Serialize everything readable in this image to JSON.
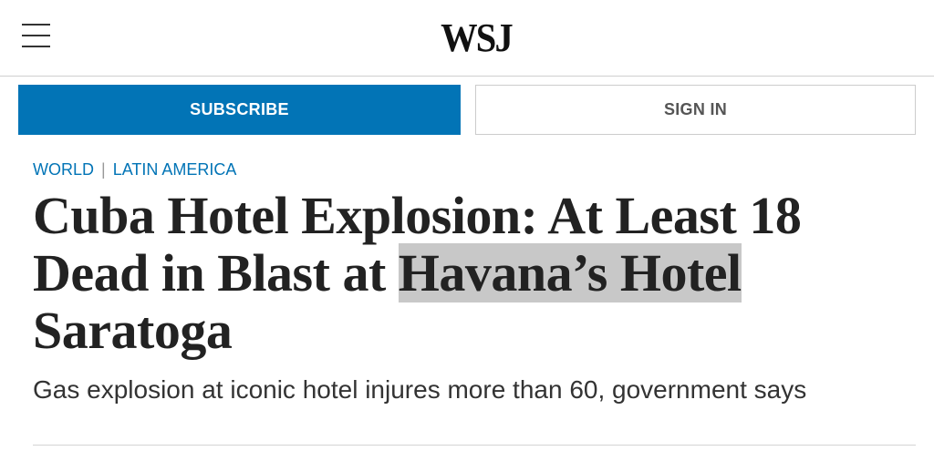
{
  "header": {
    "logo": "WSJ",
    "menu_icon": "hamburger-menu-icon"
  },
  "actions": {
    "subscribe_label": "SUBSCRIBE",
    "signin_label": "SIGN IN"
  },
  "breadcrumb": {
    "section": "WORLD",
    "separator": "|",
    "subsection": "LATIN AMERICA"
  },
  "article": {
    "headline_part1": "Cuba Hotel Explosion: At Least 18 Dead in Blast at ",
    "headline_highlight": "Havana’s Hotel",
    "headline_part2": " Saratoga",
    "dek": "Gas explosion at iconic hotel injures more than 60, government says"
  },
  "colors": {
    "accent": "#0274b6",
    "highlight": "#c8c8c8",
    "text": "#222222"
  }
}
